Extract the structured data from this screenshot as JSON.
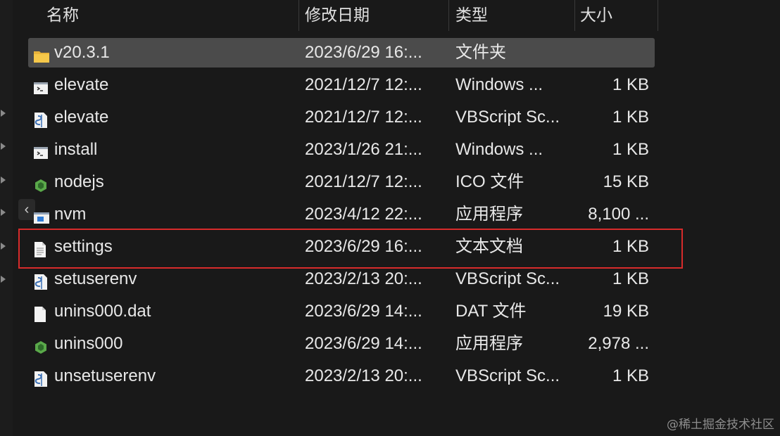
{
  "header": {
    "name": "名称",
    "date": "修改日期",
    "type": "类型",
    "size": "大小"
  },
  "files": [
    {
      "name": "v20.3.1",
      "date": "2023/6/29 16:...",
      "type": "文件夹",
      "size": "",
      "icon": "folder-icon"
    },
    {
      "name": "elevate",
      "date": "2021/12/7 12:...",
      "type": "Windows ...",
      "size": "1 KB",
      "icon": "cmd-file-icon"
    },
    {
      "name": "elevate",
      "date": "2021/12/7 12:...",
      "type": "VBScript Sc...",
      "size": "1 KB",
      "icon": "vbscript-file-icon"
    },
    {
      "name": "install",
      "date": "2023/1/26 21:...",
      "type": "Windows ...",
      "size": "1 KB",
      "icon": "cmd-file-icon"
    },
    {
      "name": "nodejs",
      "date": "2021/12/7 12:...",
      "type": "ICO 文件",
      "size": "15 KB",
      "icon": "nodejs-icon"
    },
    {
      "name": "nvm",
      "date": "2023/4/12 22:...",
      "type": "应用程序",
      "size": "8,100 ...",
      "icon": "app-icon"
    },
    {
      "name": "settings",
      "date": "2023/6/29 16:...",
      "type": "文本文档",
      "size": "1 KB",
      "icon": "text-file-icon"
    },
    {
      "name": "setuserenv",
      "date": "2023/2/13 20:...",
      "type": "VBScript Sc...",
      "size": "1 KB",
      "icon": "vbscript-file-icon"
    },
    {
      "name": "unins000.dat",
      "date": "2023/6/29 14:...",
      "type": "DAT 文件",
      "size": "19 KB",
      "icon": "blank-file-icon"
    },
    {
      "name": "unins000",
      "date": "2023/6/29 14:...",
      "type": "应用程序",
      "size": "2,978 ...",
      "icon": "nodejs-icon"
    },
    {
      "name": "unsetuserenv",
      "date": "2023/2/13 20:...",
      "type": "VBScript Sc...",
      "size": "1 KB",
      "icon": "vbscript-file-icon"
    }
  ],
  "highlight_color": "#d72b2b",
  "watermark": "@稀土掘金技术社区"
}
